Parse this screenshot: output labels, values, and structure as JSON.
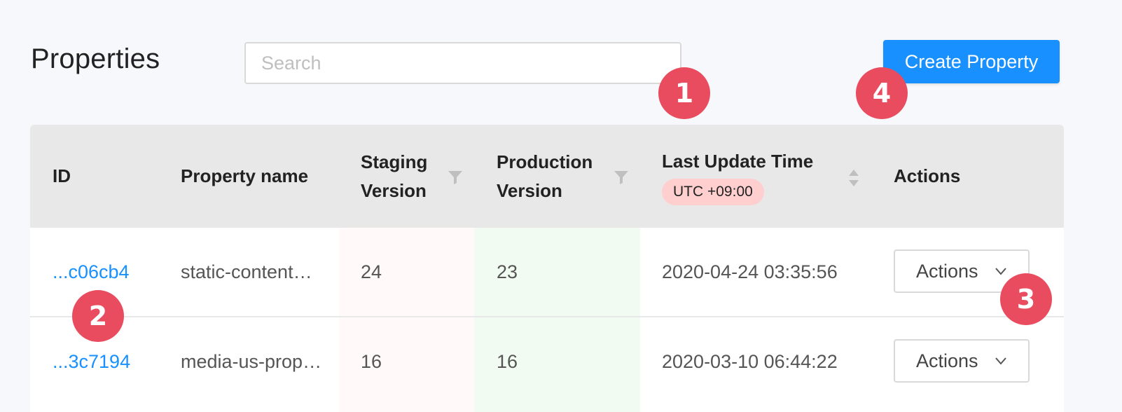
{
  "page": {
    "title": "Properties"
  },
  "search": {
    "placeholder": "Search",
    "value": ""
  },
  "create_button": {
    "label": "Create Property"
  },
  "table": {
    "headers": {
      "id": "ID",
      "property_name": "Property name",
      "staging_line1": "Staging",
      "staging_line2": "Version",
      "production_line1": "Production",
      "production_line2": "Version",
      "last_update": "Last Update Time",
      "timezone_badge": "UTC +09:00",
      "actions": "Actions"
    },
    "rows": [
      {
        "id": "...c06cb4",
        "property_name": "static-content…",
        "staging_version": "24",
        "production_version": "23",
        "last_update": "2020-04-24 03:35:56",
        "actions_label": "Actions"
      },
      {
        "id": "...3c7194",
        "property_name": "media-us-prop…",
        "staging_version": "16",
        "production_version": "16",
        "last_update": "2020-03-10 06:44:22",
        "actions_label": "Actions"
      }
    ]
  },
  "markers": [
    "1",
    "2",
    "3",
    "4"
  ],
  "colors": {
    "accent": "#1890ff",
    "marker": "#e94c5f",
    "staging_column": "#fff9f9",
    "production_column": "#f1fbf2",
    "timezone_badge": "#ffcfcf"
  },
  "icons": {
    "filter": "filter-icon",
    "sort": "sort-icon",
    "dropdown": "chevron-down-icon"
  }
}
